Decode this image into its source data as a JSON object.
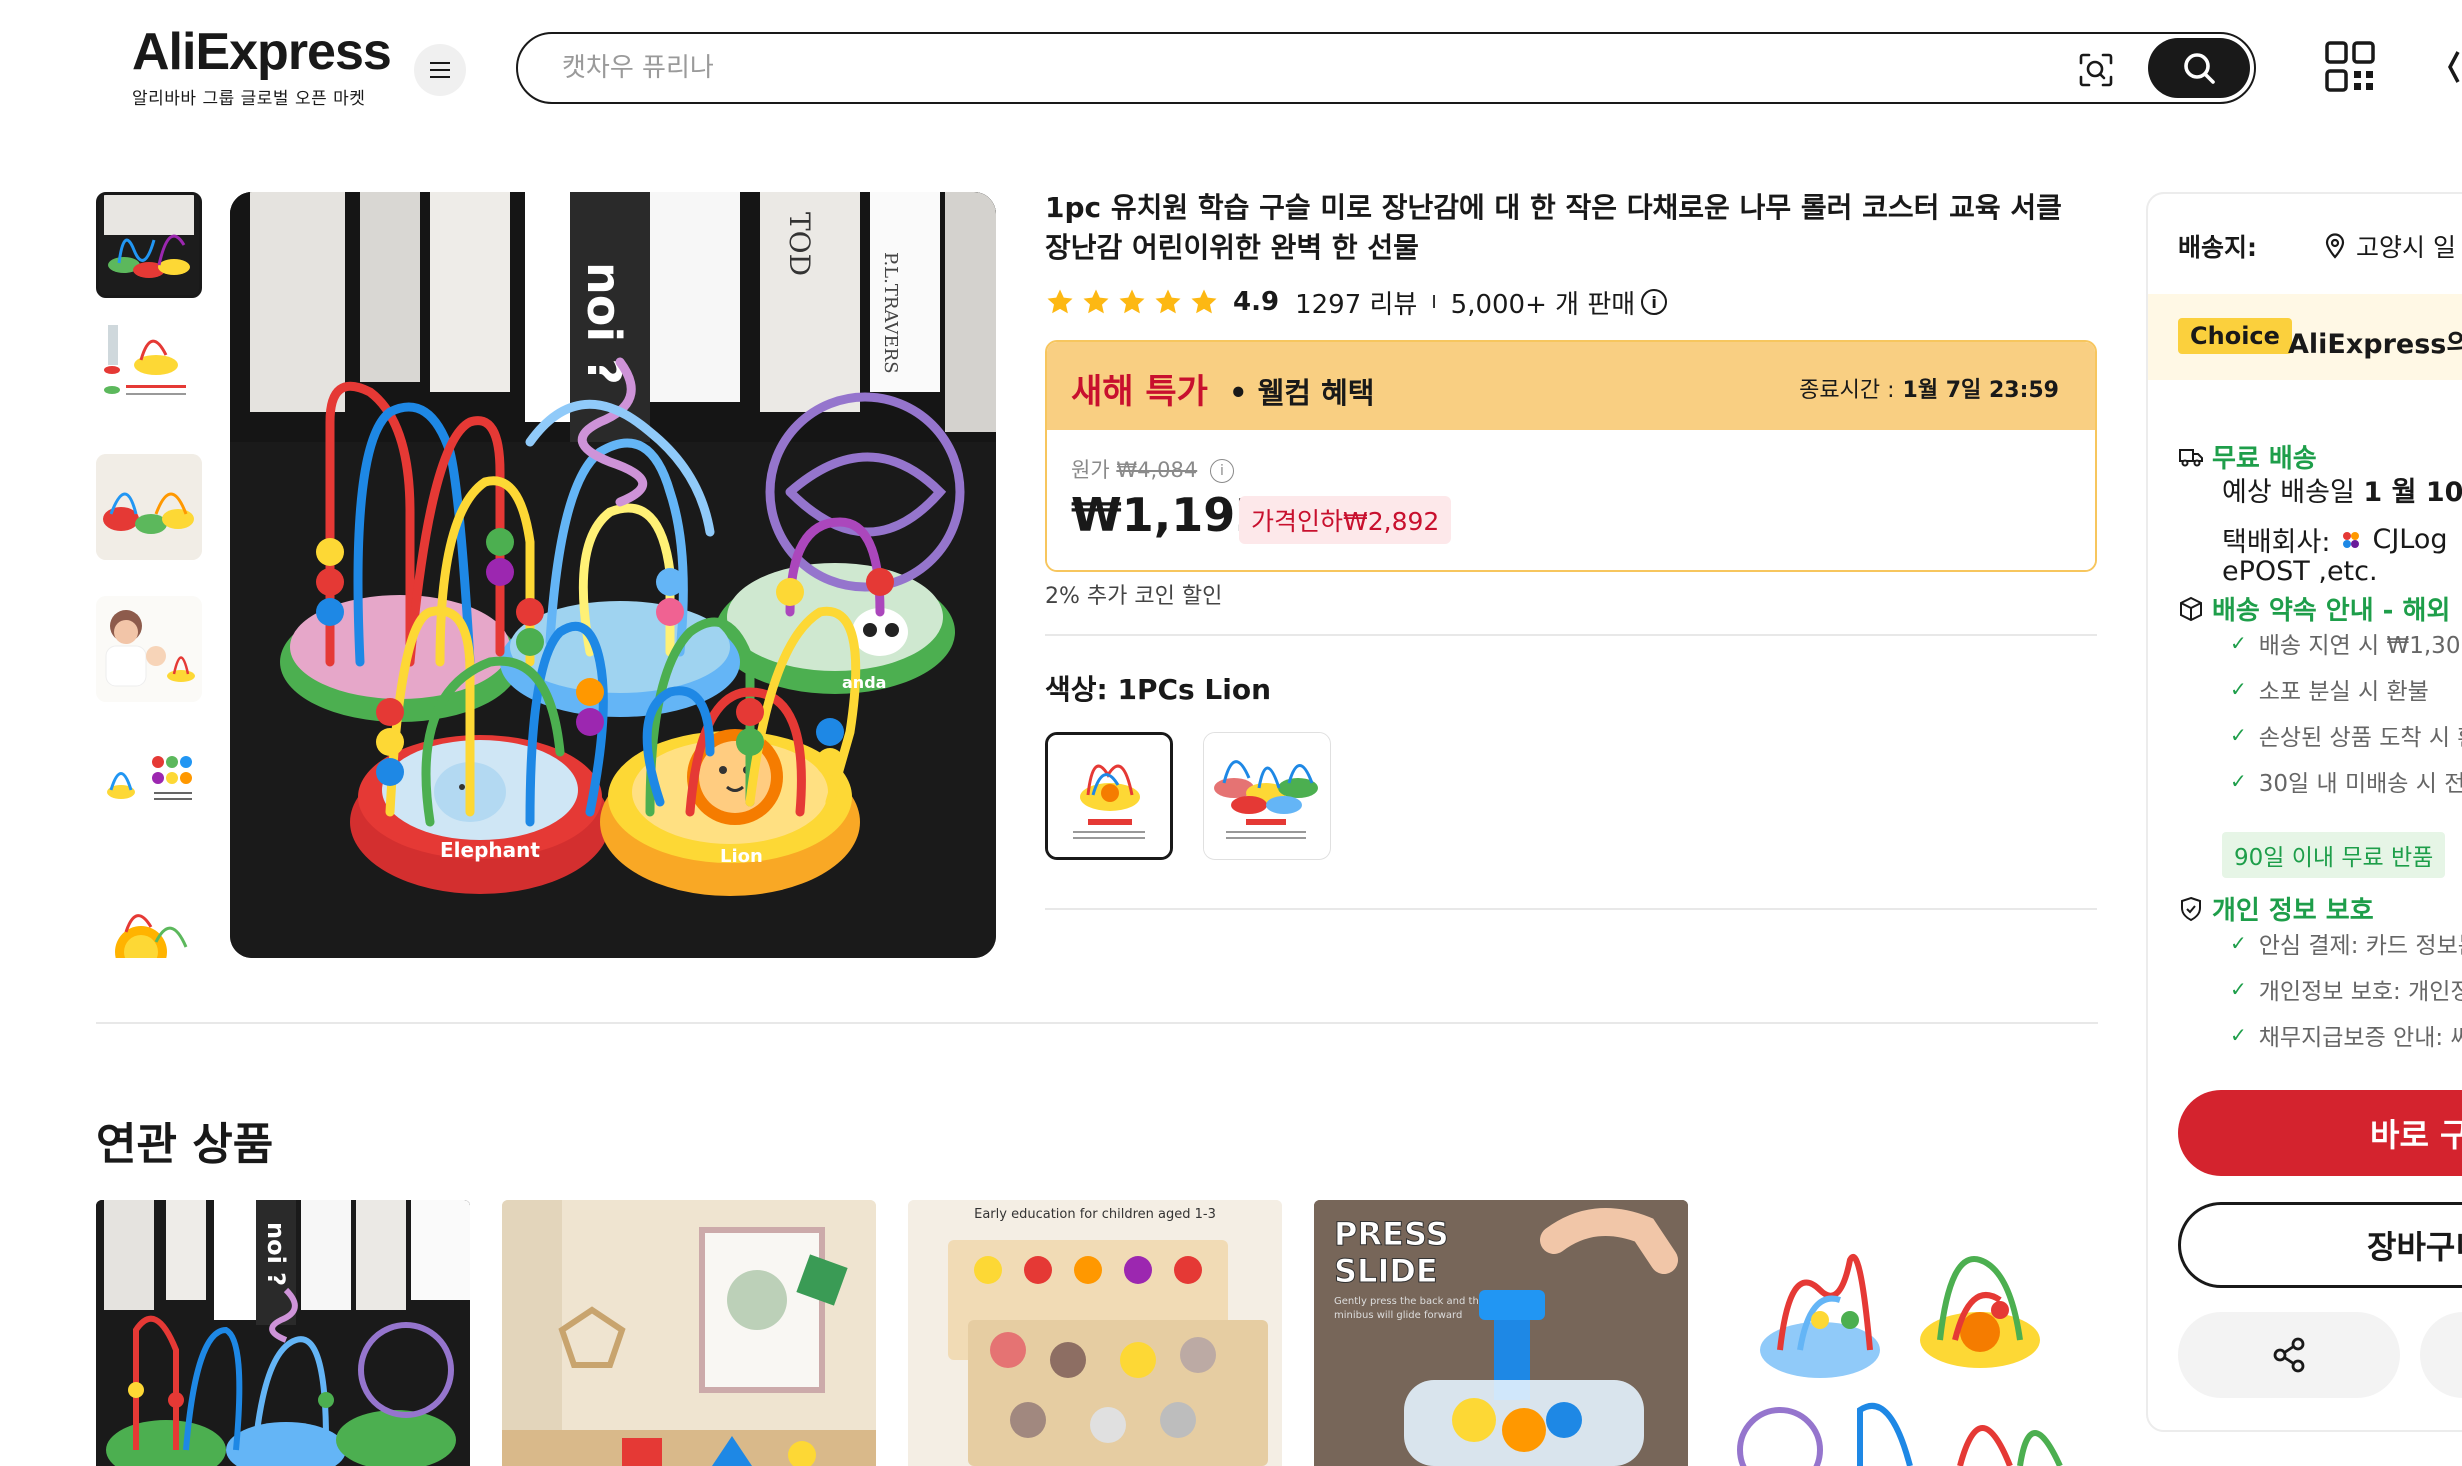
{
  "header": {
    "logo": "AliExpress",
    "logo_sub": "알리바바 그룹 글로벌 오픈 마켓",
    "search_placeholder": "캣차우 퓨리나"
  },
  "product": {
    "title": "1pc 유치원 학습 구슬 미로 장난감에 대 한 작은 다채로운 나무 롤러 코스터 교육 서클 장난감 어린이위한 완벽 한 선물",
    "rating": "4.9",
    "reviews": "1297 리뷰",
    "separator": "I",
    "sold": "5,000+ 개 판매",
    "info_icon_label": "i",
    "deal": {
      "title": "새해 특가",
      "subtitle": "• 웰컴 혜택",
      "end_label": "종료시간 :",
      "end_time": "1월 7일 23:59",
      "orig_label": "원가",
      "orig_price": "₩4,084",
      "price": "₩1,192",
      "discount": "가격인하₩2,892"
    },
    "coin_text": "2% 추가 코인 할인",
    "color_label": "색상: 1PCs Lion",
    "image_labels": {
      "elephant": "Elephant",
      "lion": "Lion",
      "panda": "anda"
    }
  },
  "related": {
    "title": "연관 상품",
    "card3_caption": "Early education for children aged 1-3",
    "card4_caption1": "PRESS",
    "card4_caption2": "SLIDE",
    "card4_caption3": "Gently press the back and the",
    "card4_caption4": "minibus will glide forward"
  },
  "panel": {
    "ship_to_label": "배송지:",
    "ship_to_value": "고양시 일",
    "choice_tag": "Choice",
    "choice_text": "AliExpress의 ?",
    "free_shipping": "무료 배송",
    "delivery_label": "예상 배송일",
    "delivery_date": "1 월 10",
    "carrier_label": "택배회사:",
    "carrier_name": "CJLog",
    "carrier_more": "ePOST ,etc.",
    "promise_title": "배송 약속 안내 - 해외 !",
    "promise_items": [
      "배송 지연 시 ₩1,300 ",
      "소포 분실 시 환불",
      "손상된 상품 도착 시 환",
      "30일 내 미배송 시 전액"
    ],
    "free_return": "90일 이내 무료 반품",
    "privacy_title": "개인 정보 보호",
    "privacy_items": [
      "안심 결제: 카드 정보는",
      "개인정보 보호: 개인정",
      "채무지급보증 안내: 씨"
    ],
    "buy_now": "바로 구",
    "add_cart": "장바구니"
  },
  "colors": {
    "brand_red": "#d4232e",
    "deal_orange": "#f9cf82",
    "star_gold": "#fdb813",
    "green": "#1e9e4a"
  }
}
